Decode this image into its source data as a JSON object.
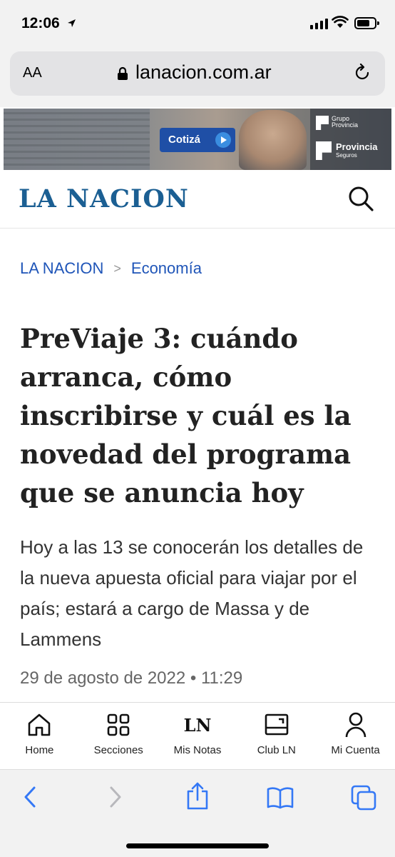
{
  "status": {
    "time": "12:06"
  },
  "browser": {
    "aa_label": "AA",
    "url": "lanacion.com.ar"
  },
  "ad": {
    "cta": "Cotizá",
    "brand_top_1": "Grupo",
    "brand_top_2": "Provincia",
    "brand_main": "Provincia",
    "brand_sub": "Seguros"
  },
  "site": {
    "logo": "LA NACION"
  },
  "breadcrumb": {
    "home": "LA NACION",
    "separator": ">",
    "section": "Economía"
  },
  "article": {
    "headline": "PreViaje 3: cuándo arranca, cómo inscribirse y cuál es la novedad del programa que se anuncia hoy",
    "summary": "Hoy a las 13 se conocerán los detalles de la nueva apuesta oficial para viajar por el país; estará a cargo de Massa y de Lammens",
    "date": "29 de agosto de 2022 • 11:29"
  },
  "nav": {
    "items": [
      {
        "label": "Home",
        "icon": "home-icon"
      },
      {
        "label": "Secciones",
        "icon": "grid-icon"
      },
      {
        "label": "Mis Notas",
        "icon": "ln-icon",
        "glyph": "LN"
      },
      {
        "label": "Club LN",
        "icon": "club-card-icon"
      },
      {
        "label": "Mi Cuenta",
        "icon": "user-icon"
      }
    ]
  },
  "colors": {
    "brand": "#1b5f93",
    "link": "#1f55b8",
    "ios_blue": "#3478f6"
  }
}
